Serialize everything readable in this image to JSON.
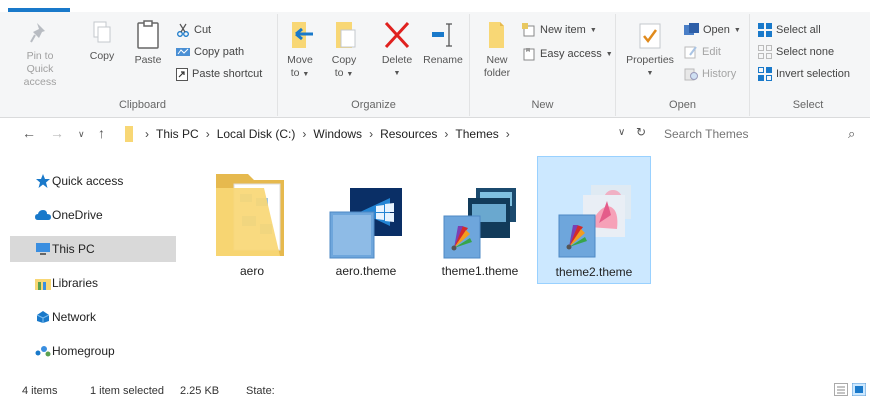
{
  "ribbon": {
    "clipboard": {
      "label": "Clipboard",
      "pin_label_1": "Pin to Quick",
      "pin_label_2": "access",
      "copy": "Copy",
      "paste": "Paste",
      "cut": "Cut",
      "copy_path": "Copy path",
      "paste_shortcut": "Paste shortcut"
    },
    "organize": {
      "label": "Organize",
      "move_to_1": "Move",
      "move_to_2": "to",
      "copy_to_1": "Copy",
      "copy_to_2": "to",
      "delete": "Delete",
      "rename": "Rename"
    },
    "new": {
      "label": "New",
      "new_folder_1": "New",
      "new_folder_2": "folder",
      "new_item": "New item",
      "easy_access": "Easy access"
    },
    "open": {
      "label": "Open",
      "properties": "Properties",
      "open": "Open",
      "edit": "Edit",
      "history": "History"
    },
    "select": {
      "label": "Select",
      "select_all": "Select all",
      "select_none": "Select none",
      "invert_selection": "Invert selection"
    }
  },
  "address": {
    "crumbs": [
      "This PC",
      "Local Disk (C:)",
      "Windows",
      "Resources",
      "Themes"
    ]
  },
  "search": {
    "placeholder": "Search Themes"
  },
  "nav": {
    "items": [
      {
        "label": "Quick access",
        "icon": "star-icon"
      },
      {
        "label": "OneDrive",
        "icon": "cloud-icon"
      },
      {
        "label": "This PC",
        "icon": "computer-icon",
        "selected": true
      },
      {
        "label": "Libraries",
        "icon": "libraries-icon"
      },
      {
        "label": "Network",
        "icon": "network-icon"
      },
      {
        "label": "Homegroup",
        "icon": "homegroup-icon"
      }
    ]
  },
  "files": [
    {
      "name": "aero",
      "type": "folder"
    },
    {
      "name": "aero.theme",
      "type": "theme"
    },
    {
      "name": "theme1.theme",
      "type": "theme"
    },
    {
      "name": "theme2.theme",
      "type": "theme",
      "selected": true
    }
  ],
  "status": {
    "item_count": "4 items",
    "selection": "1 item selected",
    "size": "2.25 KB",
    "state": "State:"
  },
  "colors": {
    "accent": "#1979ca",
    "selection_bg": "#cce8ff",
    "folder_yellow": "#f8d775"
  }
}
